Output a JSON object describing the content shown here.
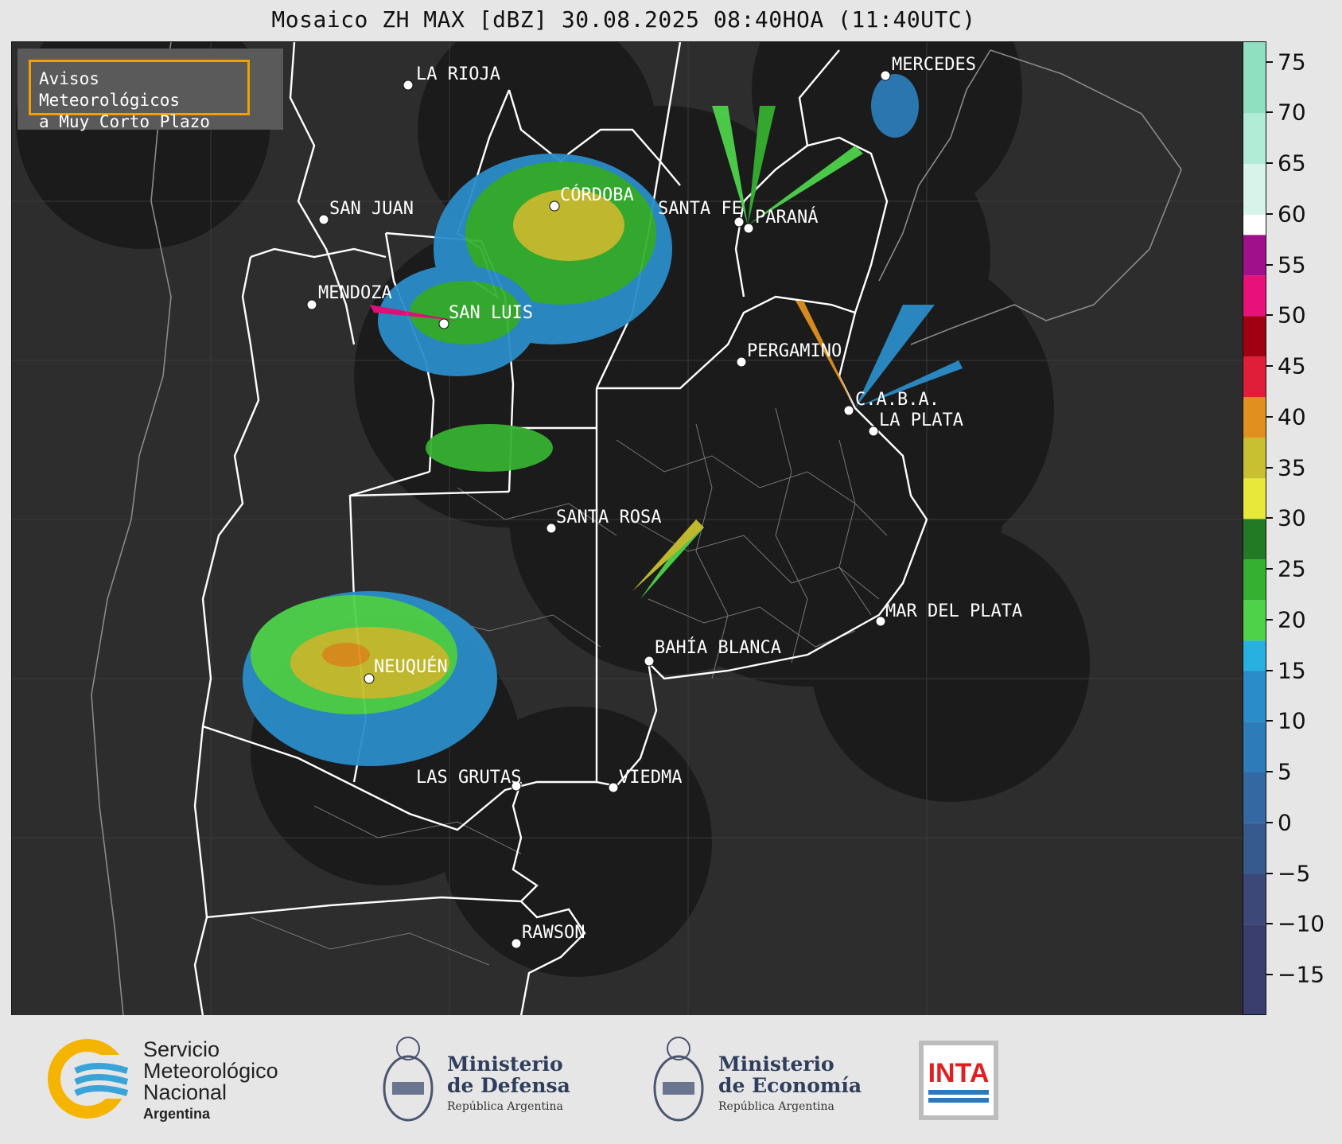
{
  "title": "Mosaico ZH MAX [dBZ] 30.08.2025 08:40HOA (11:40UTC)",
  "notice": {
    "line1": "Avisos Meteorológicos",
    "line2": "a Muy Corto Plazo",
    "border_color": "#f0a000"
  },
  "cities": [
    {
      "name": "LA RIOJA"
    },
    {
      "name": "CÓRDOBA"
    },
    {
      "name": "SAN JUAN"
    },
    {
      "name": "SANTA FE"
    },
    {
      "name": "PARANÁ"
    },
    {
      "name": "MENDOZA"
    },
    {
      "name": "SAN LUIS"
    },
    {
      "name": "MERCEDES"
    },
    {
      "name": "PERGAMINO"
    },
    {
      "name": "C.A.B.A."
    },
    {
      "name": "LA PLATA"
    },
    {
      "name": "SANTA ROSA"
    },
    {
      "name": "MAR DEL PLATA"
    },
    {
      "name": "BAHÍA BLANCA"
    },
    {
      "name": "NEUQUÉN"
    },
    {
      "name": "LAS GRUTAS"
    },
    {
      "name": "VIEDMA"
    },
    {
      "name": "RAWSON"
    }
  ],
  "colorbar": {
    "min": -19,
    "max": 77,
    "ticks": [
      "75",
      "70",
      "65",
      "60",
      "55",
      "50",
      "45",
      "40",
      "35",
      "30",
      "25",
      "20",
      "15",
      "10",
      "5",
      "0",
      "−5",
      "−10",
      "−15"
    ],
    "tick_values": [
      75,
      70,
      65,
      60,
      55,
      50,
      45,
      40,
      35,
      30,
      25,
      20,
      15,
      10,
      5,
      0,
      -5,
      -10,
      -15
    ],
    "bands": [
      {
        "from": -19,
        "to": -10,
        "color": "#3a3e6e"
      },
      {
        "from": -10,
        "to": -5,
        "color": "#3b4878"
      },
      {
        "from": -5,
        "to": 0,
        "color": "#375a8e"
      },
      {
        "from": 0,
        "to": 5,
        "color": "#3468a3"
      },
      {
        "from": 5,
        "to": 10,
        "color": "#2d7bb8"
      },
      {
        "from": 10,
        "to": 15,
        "color": "#2a8cc8"
      },
      {
        "from": 15,
        "to": 18,
        "color": "#28b0e0"
      },
      {
        "from": 18,
        "to": 22,
        "color": "#4ed24a"
      },
      {
        "from": 22,
        "to": 26,
        "color": "#36b030"
      },
      {
        "from": 26,
        "to": 30,
        "color": "#237a24"
      },
      {
        "from": 30,
        "to": 34,
        "color": "#e8e83a"
      },
      {
        "from": 34,
        "to": 38,
        "color": "#c8c030"
      },
      {
        "from": 38,
        "to": 42,
        "color": "#e0901e"
      },
      {
        "from": 42,
        "to": 46,
        "color": "#e01e3a"
      },
      {
        "from": 46,
        "to": 50,
        "color": "#a00012"
      },
      {
        "from": 50,
        "to": 54,
        "color": "#e8107a"
      },
      {
        "from": 54,
        "to": 58,
        "color": "#a0108a"
      },
      {
        "from": 58,
        "to": 60,
        "color": "#ffffff"
      },
      {
        "from": 60,
        "to": 65,
        "color": "#d8f4ea"
      },
      {
        "from": 65,
        "to": 70,
        "color": "#b0ecd6"
      },
      {
        "from": 70,
        "to": 77,
        "color": "#8ee0c0"
      }
    ]
  },
  "footer": {
    "smn": {
      "line1": "Servicio",
      "line2": "Meteorológico",
      "line3": "Nacional",
      "line4": "Argentina"
    },
    "defensa": {
      "line1": "Ministerio",
      "line2": "de Defensa",
      "line3": "República Argentina"
    },
    "economia": {
      "line1": "Ministerio",
      "line2": "de Economía",
      "line3": "República Argentina"
    },
    "inta": {
      "label": "INTA"
    }
  },
  "colors": {
    "map_background": "#2d2d2d",
    "radar_disc": "#1b1b1b",
    "province_border": "#ffffff",
    "accent": "#f0a000"
  }
}
